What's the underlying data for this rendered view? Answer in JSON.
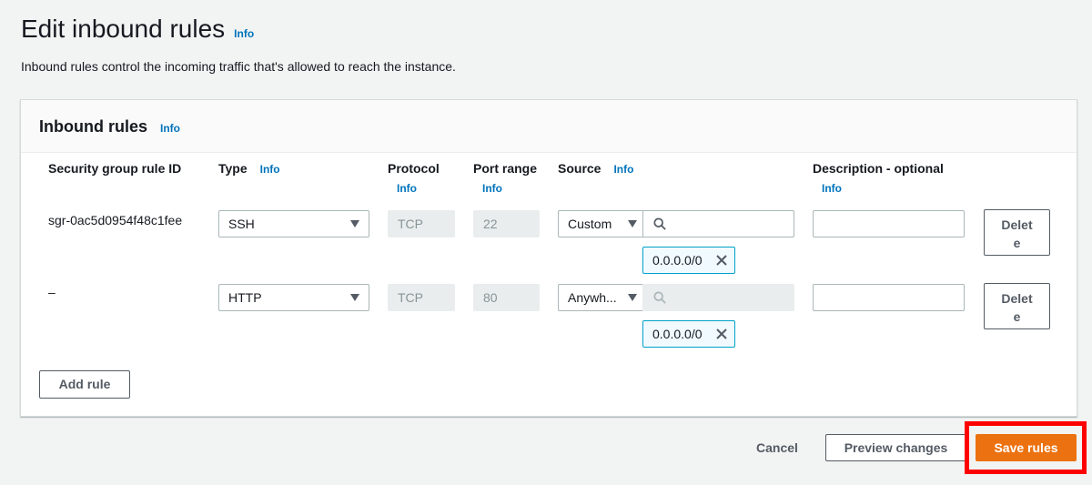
{
  "page": {
    "title": "Edit inbound rules",
    "title_info": "Info",
    "description": "Inbound rules control the incoming traffic that's allowed to reach the instance."
  },
  "panel": {
    "title": "Inbound rules",
    "title_info": "Info",
    "columns": {
      "rule_id": "Security group rule ID",
      "type": "Type",
      "type_info": "Info",
      "protocol": "Protocol",
      "protocol_info": "Info",
      "port_range": "Port range",
      "port_range_info": "Info",
      "source": "Source",
      "source_info": "Info",
      "description": "Description - optional",
      "description_info": "Info"
    },
    "rules": [
      {
        "rule_id": "sgr-0ac5d0954f48c1fee",
        "type": "SSH",
        "protocol": "TCP",
        "port_range": "22",
        "source": "Custom",
        "source_search_value": "",
        "cidr_token": "0.0.0.0/0",
        "description_value": "",
        "delete_label": "Delete"
      },
      {
        "rule_id": "–",
        "type": "HTTP",
        "protocol": "TCP",
        "port_range": "80",
        "source": "Anywh...",
        "source_search_value": "",
        "cidr_token": "0.0.0.0/0",
        "description_value": "",
        "delete_label": "Delete"
      }
    ],
    "add_rule_label": "Add rule"
  },
  "footer": {
    "cancel_label": "Cancel",
    "preview_label": "Preview changes",
    "save_label": "Save rules"
  },
  "colors": {
    "primary_button": "#ec7211",
    "link": "#0073bb",
    "highlight": "#ff0000",
    "token_border": "#00a1c9"
  },
  "icons": {
    "caret": "caret-down-icon",
    "search": "search-icon",
    "remove": "close-icon"
  }
}
